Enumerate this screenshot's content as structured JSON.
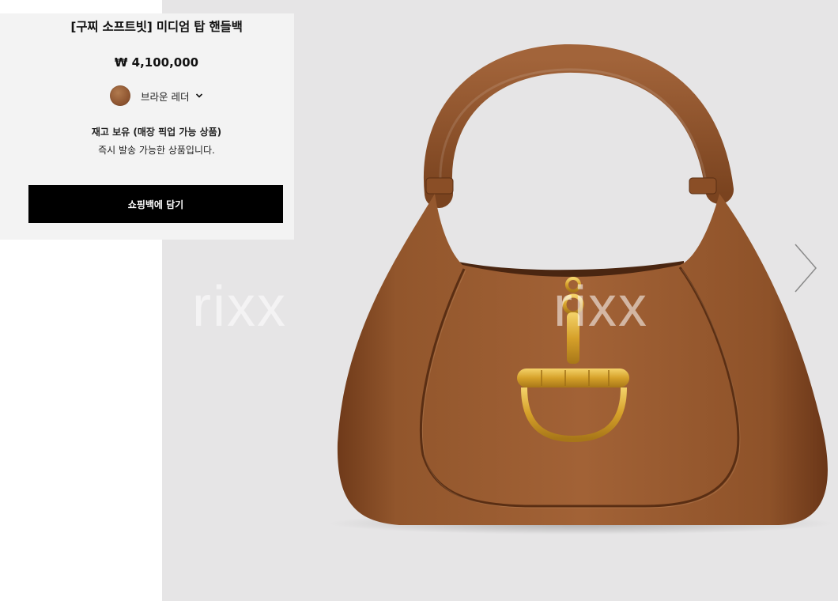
{
  "product": {
    "title": "[구찌 소프트빗] 미디엄 탑 핸들백",
    "price": "₩ 4,100,000",
    "color_label": "브라운 레더",
    "stock_status": "재고 보유 (매장 픽업 가능 상품)",
    "shipping_note": "즉시 발송 가능한 상품입니다.",
    "add_to_bag_label": "쇼핑백에 담기",
    "swatch_color": "#8f5631"
  },
  "gallery": {
    "watermark_left": "rixx",
    "watermark_center": "rixx",
    "next_icon": "chevron-right-icon"
  },
  "colors": {
    "gallery_bg": "#e6e5e6",
    "panel_bg": "#f3f3f3",
    "cta_bg": "#000000",
    "bag_leather": "#8a4f27",
    "hardware_gold": "#d9a82e"
  }
}
